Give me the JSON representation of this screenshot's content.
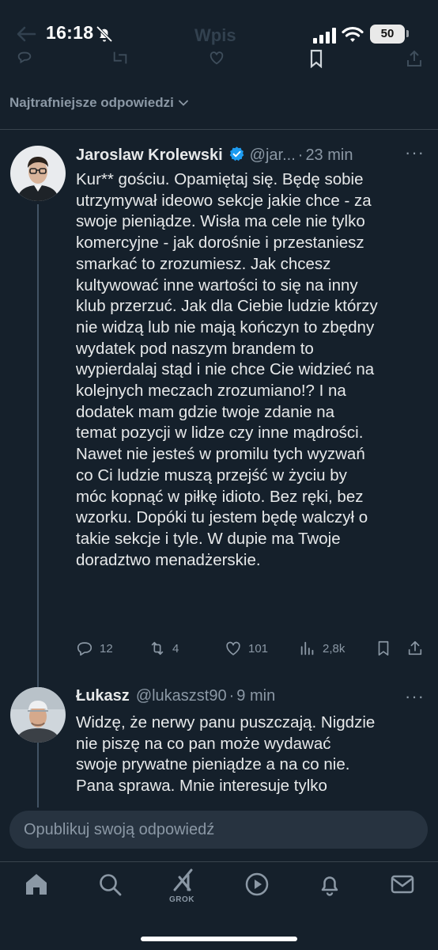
{
  "status_bar": {
    "time": "16:18",
    "battery": "50"
  },
  "page_title": "Wpis",
  "sort_header": "Najtrafniejsze odpowiedzi",
  "tweets": [
    {
      "name": "Jaroslaw Krolewski",
      "verified": true,
      "handle": "@jar...",
      "dot": "·",
      "time": "23 min",
      "body": "Kur** gościu. Opamiętaj się. Będę sobie\nutrzymywał ideowo sekcje jakie chce - za\nswoje pieniądze. Wisła ma cele nie tylko\nkomercyjne - jak dorośnie i przestaniesz\nsmarkać to zrozumiesz. Jak chcesz\nkultywować inne wartości to się na inny\nklub przerzuć. Jak dla Ciebie ludzie którzy\nnie widzą lub nie mają kończyn to zbędny\nwydatek pod naszym brandem to\nwypierdalaj stąd i nie chce Cie widzieć na\nkolejnych meczach zrozumiano!? I na\ndodatek mam gdzie twoje zdanie na\ntemat pozycji w lidze czy inne mądrości.\nNawet nie jesteś w promilu tych wyzwań\nco Ci ludzie muszą przejść w życiu by\nmóc kopnąć w piłkę idioto. Bez ręki, bez\nwzorku. Dopóki tu jestem będę walczył o\ntakie sekcje i tyle. W dupie ma Twoje\ndoradztwo menadżerskie.",
      "replies": "12",
      "retweets": "4",
      "likes": "101",
      "views": "2,8k"
    },
    {
      "name": "Łukasz",
      "handle": "@lukaszst90",
      "dot": "·",
      "time": "9 min",
      "body": "Widzę, że nerwy panu puszczają. Nigdzie\nnie piszę na co pan może wydawać\nswoje prywatne pieniądze a na co nie.\nPana sprawa. Mnie interesuje tylko"
    }
  ],
  "composer_placeholder": "Opublikuj swoją odpowiedź",
  "nav": {
    "grok_label": "GROK"
  },
  "colors": {
    "background": "#15202b",
    "text": "#e7e9ea",
    "muted": "#8b98a5",
    "verified": "#1d9bf0",
    "divider": "#38444d"
  }
}
